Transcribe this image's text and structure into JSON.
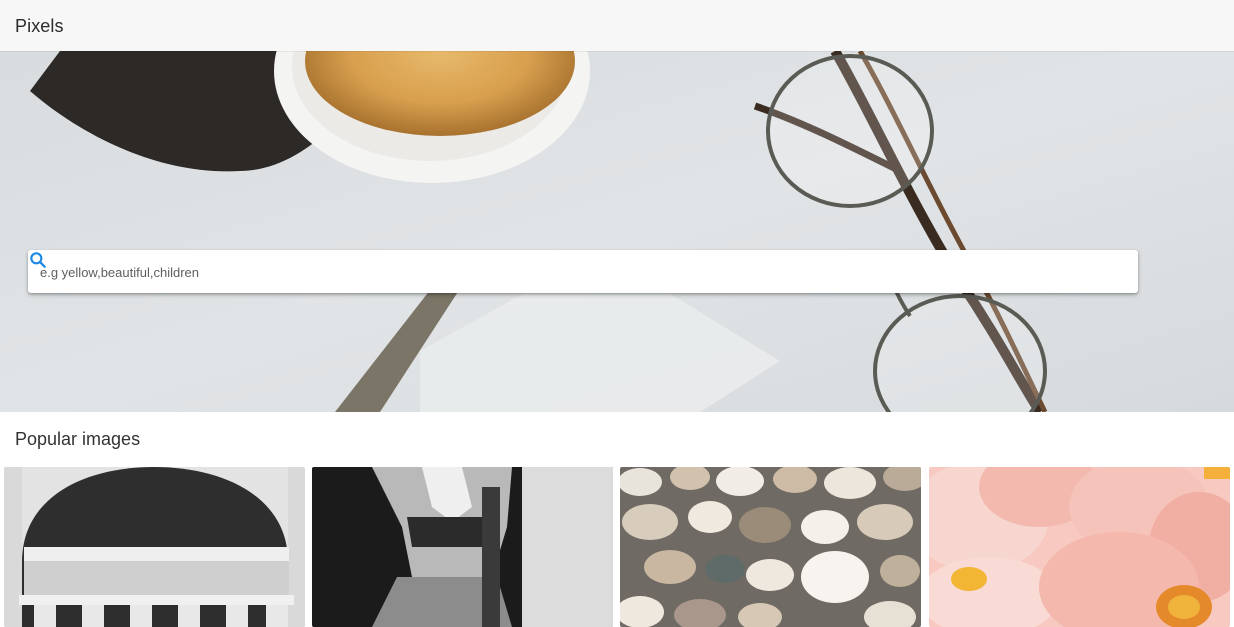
{
  "app": {
    "title": "Pixels"
  },
  "search": {
    "placeholder": "e.g yellow,beautiful,children",
    "value": "",
    "icon": "search-icon"
  },
  "popular": {
    "title": "Popular images",
    "images": [
      {
        "name": "building-columns",
        "description": "black and white building with columns"
      },
      {
        "name": "woman-jeans",
        "description": "black and white woman in jeans"
      },
      {
        "name": "pebbles",
        "description": "pile of pebbles"
      },
      {
        "name": "pink-flowers",
        "description": "pink peony flowers"
      }
    ]
  },
  "colors": {
    "accent": "#1e88e5",
    "appbar": "#f7f7f7"
  }
}
